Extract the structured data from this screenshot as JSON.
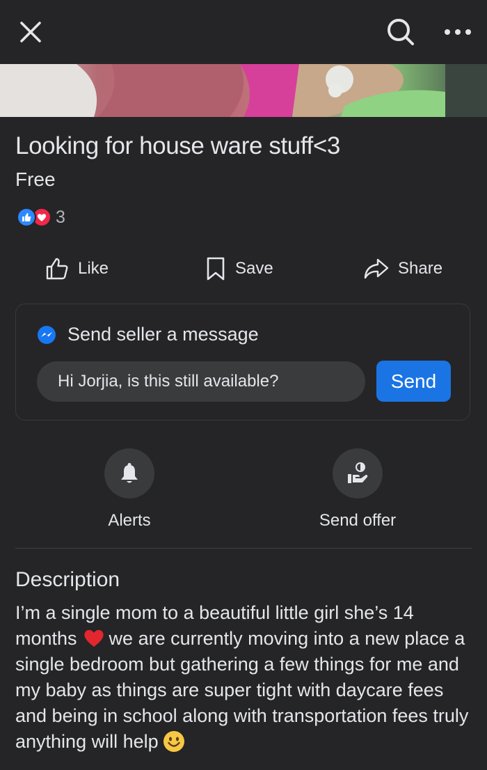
{
  "header": {
    "close_icon": "close-icon",
    "search_icon": "search-icon",
    "more_icon": "more-horizontal-icon"
  },
  "listing": {
    "title": "Looking for house ware stuff<3",
    "price": "Free",
    "reaction_count": "3",
    "reaction_icons": [
      "like-reaction-icon",
      "love-reaction-icon"
    ]
  },
  "actions": {
    "like_label": "Like",
    "save_label": "Save",
    "share_label": "Share"
  },
  "message": {
    "heading": "Send seller a message",
    "input_value": "Hi Jorjia, is this still available?",
    "send_label": "Send"
  },
  "quick_actions": {
    "alerts_label": "Alerts",
    "offer_label": "Send offer"
  },
  "description": {
    "heading": "Description",
    "part1": "I’m a single mom to a beautiful little girl she’s 14 months",
    "part2": "we are currently moving into a new place a single bedroom but gathering a few things for me and my baby as things are super tight with daycare fees and being in school along with transportation fees truly anything will help"
  },
  "colors": {
    "background": "#252527",
    "accent": "#1b74e4",
    "like": "#2d88ff",
    "love": "#f02849",
    "muted_text": "#b0b3b8"
  }
}
